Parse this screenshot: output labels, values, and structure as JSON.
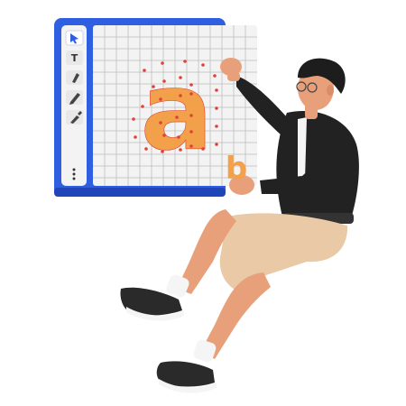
{
  "editor": {
    "toolbar": {
      "tools": [
        {
          "name": "pointer",
          "icon": "cursor-arrow-icon",
          "active": true
        },
        {
          "name": "text",
          "icon": "text-tool-icon",
          "glyph": "T",
          "active": false
        },
        {
          "name": "pen",
          "icon": "pen-tool-icon",
          "active": false
        },
        {
          "name": "pencil",
          "icon": "pencil-tool-icon",
          "active": false
        },
        {
          "name": "eyedropper",
          "icon": "eyedropper-tool-icon",
          "active": false
        }
      ],
      "more_icon": "more-vertical-icon"
    },
    "canvas": {
      "glyph_main": "a",
      "glyph_secondary": "b"
    }
  },
  "colors": {
    "frame_blue": "#2f5fe0",
    "frame_blue_dark": "#1f45b8",
    "panel_white": "#f3f3f3",
    "grid_line": "#bdbdbd",
    "letter_orange": "#f2a04a",
    "anchor_red": "#e0413a",
    "jacket_black": "#222222",
    "shorts_beige": "#e9c9a6",
    "skin": "#e8a07a",
    "sock_white": "#f5f5f5",
    "shoe_black": "#2a2a2a"
  }
}
